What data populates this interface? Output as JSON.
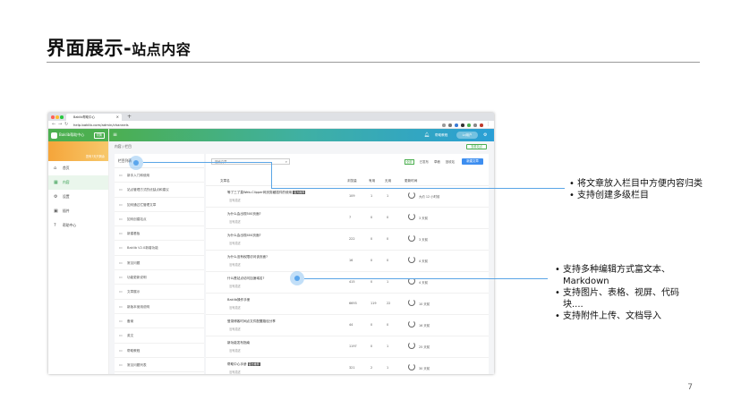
{
  "slide": {
    "title": "界面展示-",
    "title_sub": "站点内容",
    "page_number": "7"
  },
  "browser": {
    "tab_title": "Baklib帮助中心",
    "url": "help.baklib.com/admin/channels"
  },
  "app": {
    "brand": "Baklib帮助中心",
    "brand_button": "切换",
    "banner_text": "您有7天只剩余",
    "sidebar_items": [
      {
        "label": "首页",
        "icon": "home-icon"
      },
      {
        "label": "内容",
        "icon": "grid-icon"
      },
      {
        "label": "设置",
        "icon": "gear-icon"
      },
      {
        "label": "插件",
        "icon": "plug-icon"
      },
      {
        "label": "帮助中心",
        "icon": "help-icon"
      }
    ],
    "topbar": {
      "help": "帮助教程",
      "user": "Ld用户"
    },
    "breadcrumb": "内容 / 栏目",
    "view_button": "查看站点",
    "column_panel": {
      "header": "栏目列表",
      "items": [
        "新手入门和使用",
        "站点管理方式的优缺点和建议",
        "如何通过栏管理文章",
        "如何创建站点",
        "新建看板",
        "Baklib V2.0新增功能",
        "常见问题",
        "功能更新说明",
        "文章展示",
        "新版本使用说明",
        "备案",
        "英文",
        "帮助教程",
        "常见问题列表"
      ]
    },
    "list_panel": {
      "search_placeholder": "搜索文章",
      "filters": [
        "全部",
        "已发布",
        "草稿",
        "回收站"
      ],
      "new_button": "新建文章",
      "columns": [
        "文章名",
        "浏览量",
        "有用",
        "无用",
        "更新时间"
      ],
      "rows": [
        {
          "title": "等了三了莫Web-Clipper网页剪藏插件的使用",
          "tag": "官方推荐",
          "desc": "没有描述",
          "views": "109",
          "useful": "1",
          "useless": "1",
          "time": "大约 12 小时前"
        },
        {
          "title": "为什么会出现500页面?",
          "tag": "",
          "desc": "没有描述",
          "views": "7",
          "useful": "0",
          "useless": "0",
          "time": "3 天前"
        },
        {
          "title": "为什么会出现404页面?",
          "tag": "",
          "desc": "没有描述",
          "views": "222",
          "useful": "0",
          "useless": "0",
          "time": "3 天前"
        },
        {
          "title": "为什么没有权限访问该页面?",
          "tag": "",
          "desc": "没有描述",
          "views": "16",
          "useful": "0",
          "useless": "0",
          "time": "4 天前"
        },
        {
          "title": "什么是站点访问加速域名?",
          "tag": "",
          "desc": "没有描述",
          "views": "415",
          "useful": "0",
          "useless": "1",
          "time": "4 天前"
        },
        {
          "title": "Baklib操作手册",
          "tag": "",
          "desc": "没有描述",
          "views": "6693",
          "useful": "119",
          "useless": "22",
          "time": "10 天前"
        },
        {
          "title": "登录博客时间点文件配置路径分享",
          "tag": "",
          "desc": "没有描述",
          "views": "44",
          "useful": "0",
          "useless": "0",
          "time": "16 天前"
        },
        {
          "title": "新功能发布指南",
          "tag": "",
          "desc": "没有描述",
          "views": "1197",
          "useful": "0",
          "useless": "1",
          "time": "25 天前"
        },
        {
          "title": "帮助中心手册",
          "tag": "官方推荐",
          "desc": "没有描述",
          "views": "321",
          "useful": "2",
          "useless": "1",
          "time": "30 天前"
        }
      ]
    }
  },
  "callouts": {
    "group1": [
      "将文章放入栏目中方便内容归类",
      "支持创建多级栏目"
    ],
    "group2": [
      "支持多种编辑方式富文本、Markdown",
      "支持图片、表格、视屏、代码块....",
      "支持附件上传、文档导入"
    ]
  },
  "colors": {
    "accent_green": "#4caf50",
    "accent_blue": "#3d8ef0",
    "marker_blue": "#5aa5e6"
  }
}
